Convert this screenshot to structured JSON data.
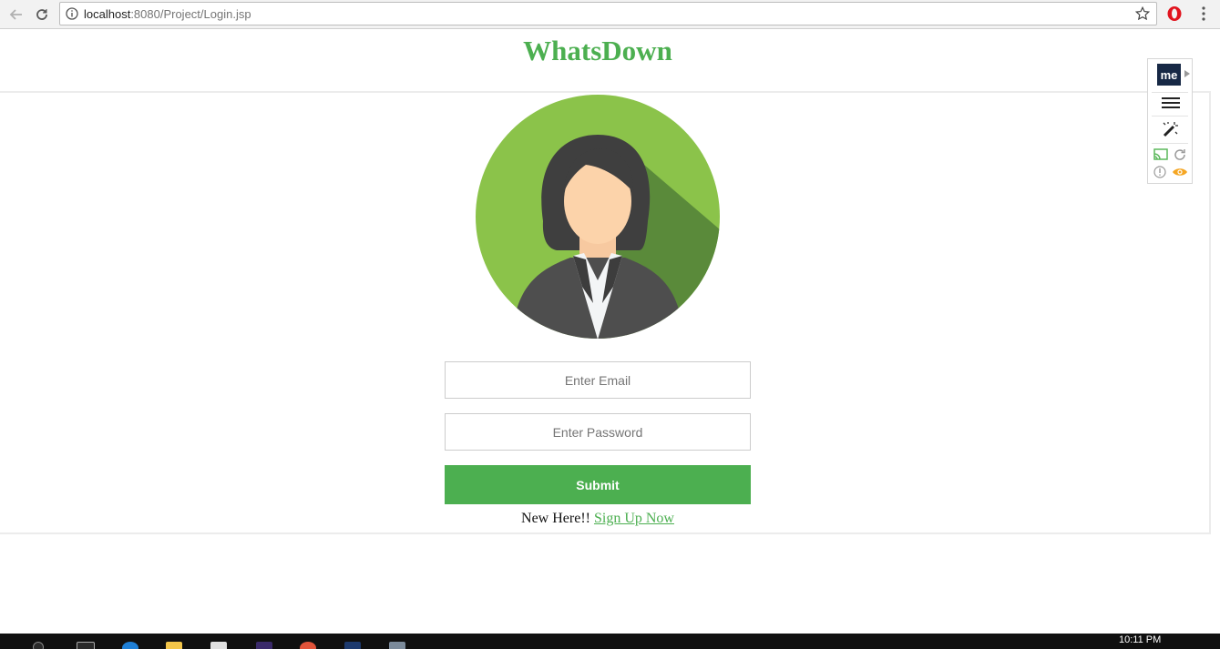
{
  "browser": {
    "url_host": "localhost",
    "url_rest": ":8080/Project/Login.jsp",
    "icons": [
      "back-arrow-icon",
      "reload-icon",
      "info-icon",
      "star-icon",
      "opera-icon",
      "menu-dots-icon"
    ]
  },
  "page": {
    "title": "WhatsDown",
    "email_placeholder": "Enter Email",
    "email_value": "",
    "password_placeholder": "Enter Password",
    "password_value": "",
    "submit_label": "Submit",
    "signup_prefix": "New Here!!",
    "signup_link": "Sign Up Now",
    "avatar": "woman-avatar-icon"
  },
  "extension_panel": {
    "logo_text": "me",
    "icons": [
      "hamburger-icon",
      "magic-wand-icon",
      "cast-icon",
      "refresh-icon",
      "info-icon",
      "eye-icon"
    ]
  },
  "taskbar": {
    "clock": "10:11 PM"
  },
  "colors": {
    "accent": "#4caf50",
    "avatar_bg": "#8bc34a",
    "panel_logo": "#172845"
  }
}
